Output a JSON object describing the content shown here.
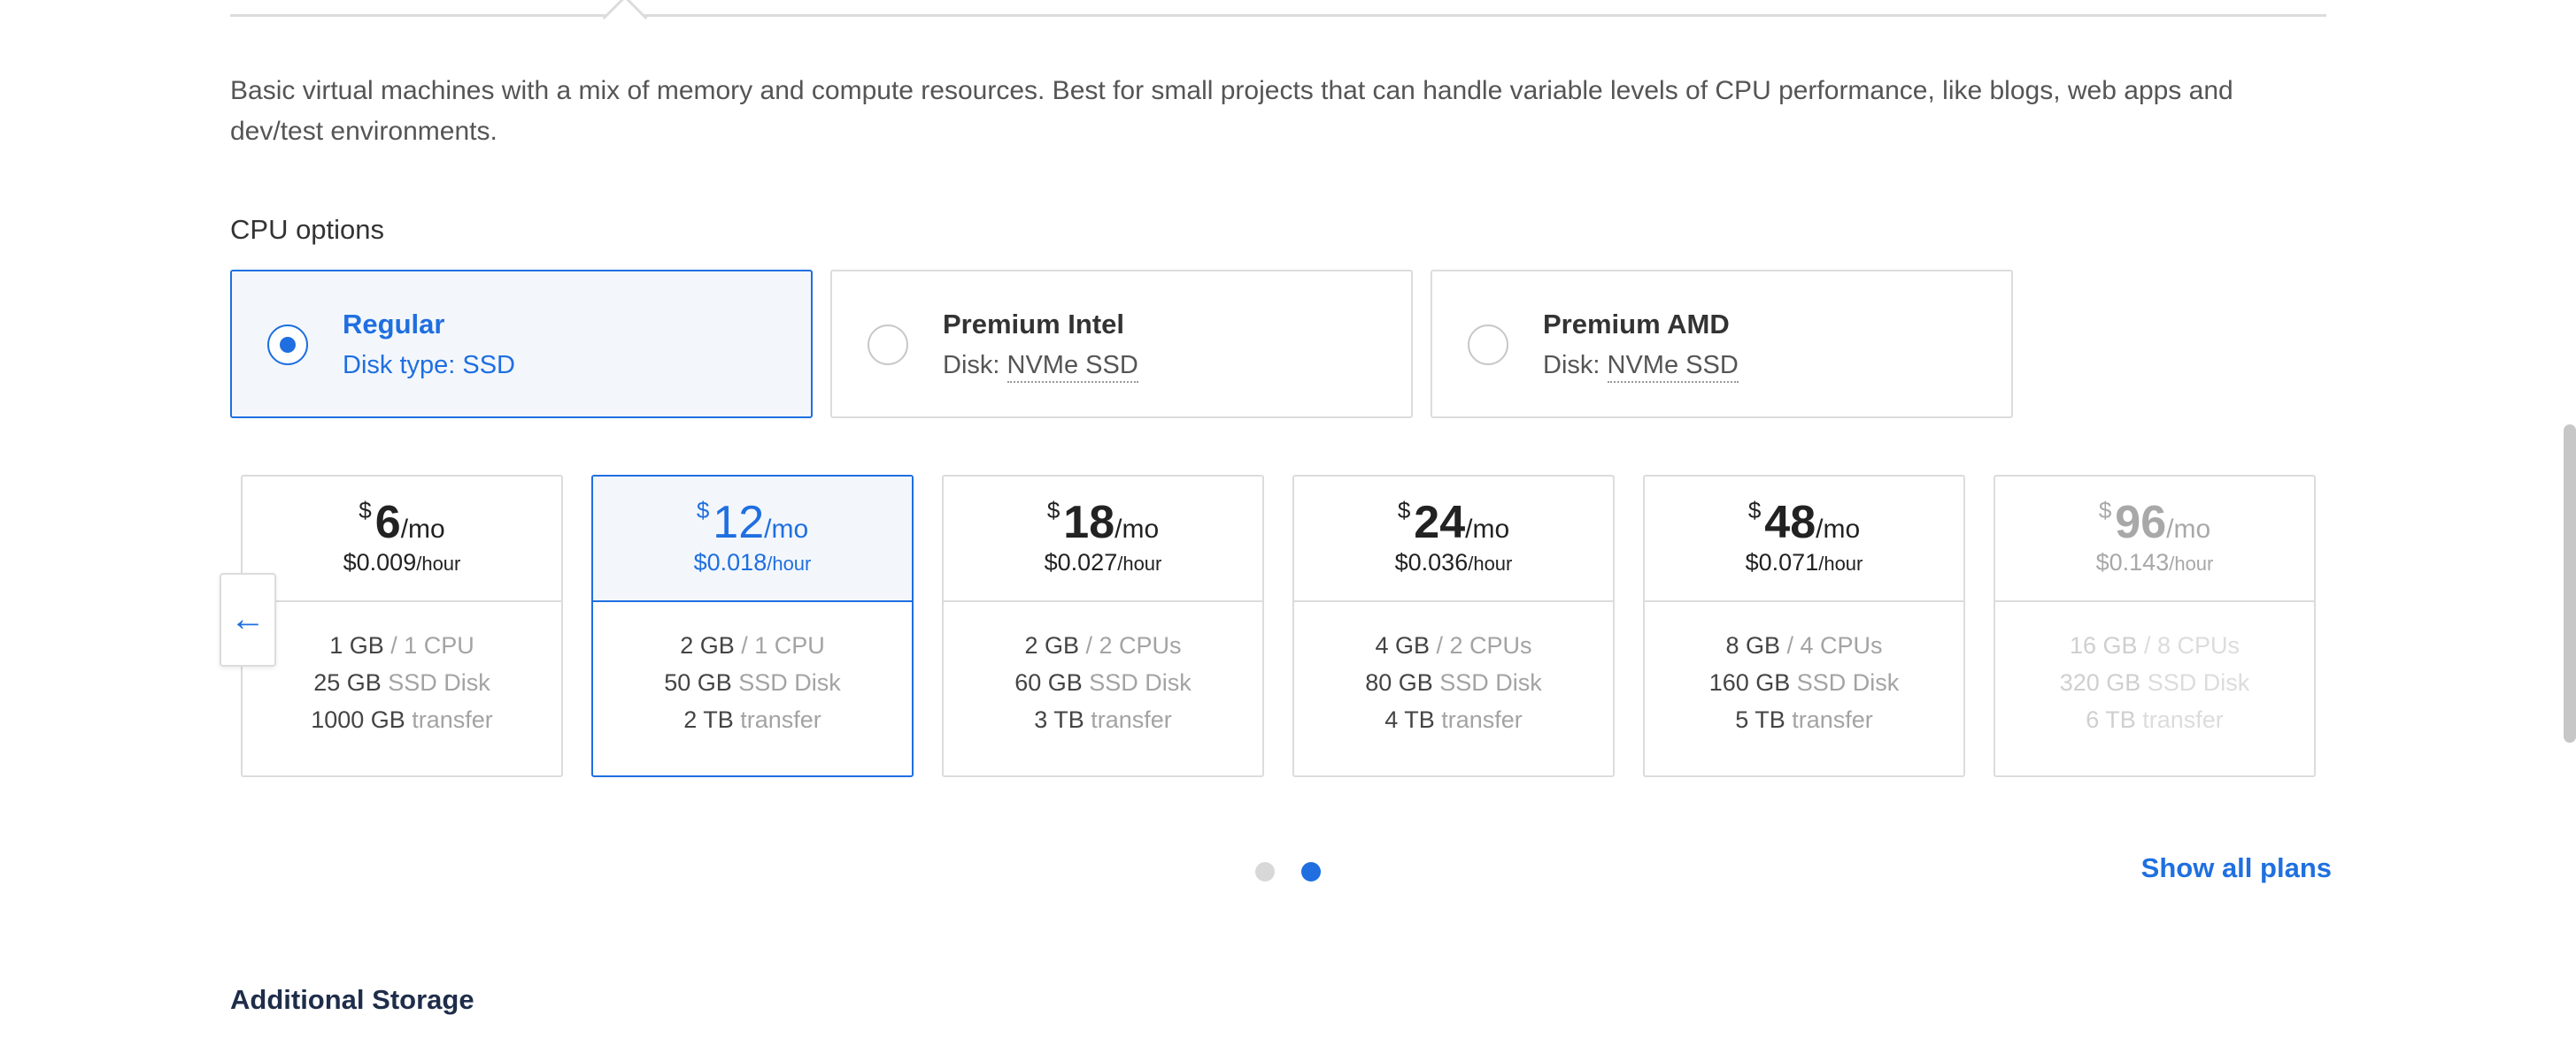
{
  "description": "Basic virtual machines with a mix of memory and compute resources. Best for small projects that can handle variable levels of CPU performance, like blogs, web apps and dev/test environments.",
  "cpu_options": {
    "title": "CPU options",
    "options": [
      {
        "name": "Regular",
        "disk_label": "Disk type: ",
        "disk_value": "SSD",
        "selected": true
      },
      {
        "name": "Premium Intel",
        "disk_label": "Disk: ",
        "disk_value": "NVMe SSD",
        "selected": false
      },
      {
        "name": "Premium AMD",
        "disk_label": "Disk: ",
        "disk_value": "NVMe SSD",
        "selected": false
      }
    ]
  },
  "plans": [
    {
      "currency": "$",
      "price": "6",
      "per_month": "/mo",
      "hourly": "$0.009",
      "per_hour": "/hour",
      "memory": "1 GB",
      "cpu": " / 1 CPU",
      "disk": "25 GB",
      "disk_type": " SSD Disk",
      "transfer": "1000 GB",
      "transfer_label": " transfer",
      "state": "normal"
    },
    {
      "currency": "$",
      "price": "12",
      "per_month": "/mo",
      "hourly": "$0.018",
      "per_hour": "/hour",
      "memory": "2 GB",
      "cpu": " / 1 CPU",
      "disk": "50 GB",
      "disk_type": " SSD Disk",
      "transfer": "2 TB",
      "transfer_label": " transfer",
      "state": "selected"
    },
    {
      "currency": "$",
      "price": "18",
      "per_month": "/mo",
      "hourly": "$0.027",
      "per_hour": "/hour",
      "memory": "2 GB",
      "cpu": " / 2 CPUs",
      "disk": "60 GB",
      "disk_type": " SSD Disk",
      "transfer": "3 TB",
      "transfer_label": " transfer",
      "state": "normal"
    },
    {
      "currency": "$",
      "price": "24",
      "per_month": "/mo",
      "hourly": "$0.036",
      "per_hour": "/hour",
      "memory": "4 GB",
      "cpu": " / 2 CPUs",
      "disk": "80 GB",
      "disk_type": " SSD Disk",
      "transfer": "4 TB",
      "transfer_label": " transfer",
      "state": "normal"
    },
    {
      "currency": "$",
      "price": "48",
      "per_month": "/mo",
      "hourly": "$0.071",
      "per_hour": "/hour",
      "memory": "8 GB",
      "cpu": " / 4 CPUs",
      "disk": "160 GB",
      "disk_type": " SSD Disk",
      "transfer": "5 TB",
      "transfer_label": " transfer",
      "state": "normal"
    },
    {
      "currency": "$",
      "price": "96",
      "per_month": "/mo",
      "hourly": "$0.143",
      "per_hour": "/hour",
      "memory": "16 GB",
      "cpu": " / 8 CPUs",
      "disk": "320 GB",
      "disk_type": " SSD Disk",
      "transfer": "6 TB",
      "transfer_label": " transfer",
      "state": "faded"
    }
  ],
  "carousel": {
    "prev_icon": "arrow-left-icon",
    "prev_glyph": "←",
    "page_count": 2,
    "active_page": 2
  },
  "show_all_label": "Show all plans",
  "additional_storage_title": "Additional Storage",
  "colors": {
    "accent": "#1f6fe0",
    "selected_bg": "#f3f7fc",
    "border": "#dcdcdc"
  }
}
